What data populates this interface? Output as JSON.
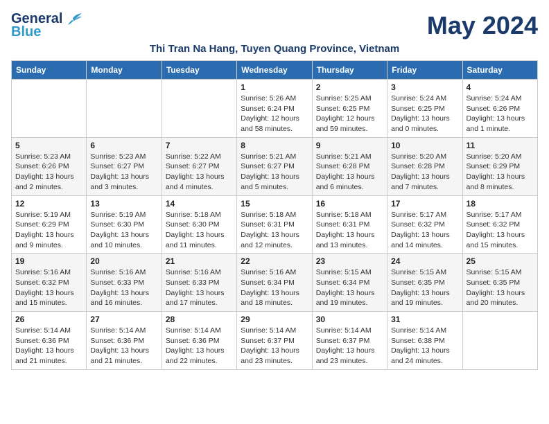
{
  "header": {
    "logo_general": "General",
    "logo_blue": "Blue",
    "month": "May 2024",
    "location": "Thi Tran Na Hang, Tuyen Quang Province, Vietnam"
  },
  "weekdays": [
    "Sunday",
    "Monday",
    "Tuesday",
    "Wednesday",
    "Thursday",
    "Friday",
    "Saturday"
  ],
  "weeks": [
    [
      {
        "day": "",
        "info": ""
      },
      {
        "day": "",
        "info": ""
      },
      {
        "day": "",
        "info": ""
      },
      {
        "day": "1",
        "info": "Sunrise: 5:26 AM\nSunset: 6:24 PM\nDaylight: 12 hours\nand 58 minutes."
      },
      {
        "day": "2",
        "info": "Sunrise: 5:25 AM\nSunset: 6:25 PM\nDaylight: 12 hours\nand 59 minutes."
      },
      {
        "day": "3",
        "info": "Sunrise: 5:24 AM\nSunset: 6:25 PM\nDaylight: 13 hours\nand 0 minutes."
      },
      {
        "day": "4",
        "info": "Sunrise: 5:24 AM\nSunset: 6:26 PM\nDaylight: 13 hours\nand 1 minute."
      }
    ],
    [
      {
        "day": "5",
        "info": "Sunrise: 5:23 AM\nSunset: 6:26 PM\nDaylight: 13 hours\nand 2 minutes."
      },
      {
        "day": "6",
        "info": "Sunrise: 5:23 AM\nSunset: 6:27 PM\nDaylight: 13 hours\nand 3 minutes."
      },
      {
        "day": "7",
        "info": "Sunrise: 5:22 AM\nSunset: 6:27 PM\nDaylight: 13 hours\nand 4 minutes."
      },
      {
        "day": "8",
        "info": "Sunrise: 5:21 AM\nSunset: 6:27 PM\nDaylight: 13 hours\nand 5 minutes."
      },
      {
        "day": "9",
        "info": "Sunrise: 5:21 AM\nSunset: 6:28 PM\nDaylight: 13 hours\nand 6 minutes."
      },
      {
        "day": "10",
        "info": "Sunrise: 5:20 AM\nSunset: 6:28 PM\nDaylight: 13 hours\nand 7 minutes."
      },
      {
        "day": "11",
        "info": "Sunrise: 5:20 AM\nSunset: 6:29 PM\nDaylight: 13 hours\nand 8 minutes."
      }
    ],
    [
      {
        "day": "12",
        "info": "Sunrise: 5:19 AM\nSunset: 6:29 PM\nDaylight: 13 hours\nand 9 minutes."
      },
      {
        "day": "13",
        "info": "Sunrise: 5:19 AM\nSunset: 6:30 PM\nDaylight: 13 hours\nand 10 minutes."
      },
      {
        "day": "14",
        "info": "Sunrise: 5:18 AM\nSunset: 6:30 PM\nDaylight: 13 hours\nand 11 minutes."
      },
      {
        "day": "15",
        "info": "Sunrise: 5:18 AM\nSunset: 6:31 PM\nDaylight: 13 hours\nand 12 minutes."
      },
      {
        "day": "16",
        "info": "Sunrise: 5:18 AM\nSunset: 6:31 PM\nDaylight: 13 hours\nand 13 minutes."
      },
      {
        "day": "17",
        "info": "Sunrise: 5:17 AM\nSunset: 6:32 PM\nDaylight: 13 hours\nand 14 minutes."
      },
      {
        "day": "18",
        "info": "Sunrise: 5:17 AM\nSunset: 6:32 PM\nDaylight: 13 hours\nand 15 minutes."
      }
    ],
    [
      {
        "day": "19",
        "info": "Sunrise: 5:16 AM\nSunset: 6:32 PM\nDaylight: 13 hours\nand 15 minutes."
      },
      {
        "day": "20",
        "info": "Sunrise: 5:16 AM\nSunset: 6:33 PM\nDaylight: 13 hours\nand 16 minutes."
      },
      {
        "day": "21",
        "info": "Sunrise: 5:16 AM\nSunset: 6:33 PM\nDaylight: 13 hours\nand 17 minutes."
      },
      {
        "day": "22",
        "info": "Sunrise: 5:16 AM\nSunset: 6:34 PM\nDaylight: 13 hours\nand 18 minutes."
      },
      {
        "day": "23",
        "info": "Sunrise: 5:15 AM\nSunset: 6:34 PM\nDaylight: 13 hours\nand 19 minutes."
      },
      {
        "day": "24",
        "info": "Sunrise: 5:15 AM\nSunset: 6:35 PM\nDaylight: 13 hours\nand 19 minutes."
      },
      {
        "day": "25",
        "info": "Sunrise: 5:15 AM\nSunset: 6:35 PM\nDaylight: 13 hours\nand 20 minutes."
      }
    ],
    [
      {
        "day": "26",
        "info": "Sunrise: 5:14 AM\nSunset: 6:36 PM\nDaylight: 13 hours\nand 21 minutes."
      },
      {
        "day": "27",
        "info": "Sunrise: 5:14 AM\nSunset: 6:36 PM\nDaylight: 13 hours\nand 21 minutes."
      },
      {
        "day": "28",
        "info": "Sunrise: 5:14 AM\nSunset: 6:36 PM\nDaylight: 13 hours\nand 22 minutes."
      },
      {
        "day": "29",
        "info": "Sunrise: 5:14 AM\nSunset: 6:37 PM\nDaylight: 13 hours\nand 23 minutes."
      },
      {
        "day": "30",
        "info": "Sunrise: 5:14 AM\nSunset: 6:37 PM\nDaylight: 13 hours\nand 23 minutes."
      },
      {
        "day": "31",
        "info": "Sunrise: 5:14 AM\nSunset: 6:38 PM\nDaylight: 13 hours\nand 24 minutes."
      },
      {
        "day": "",
        "info": ""
      }
    ]
  ]
}
